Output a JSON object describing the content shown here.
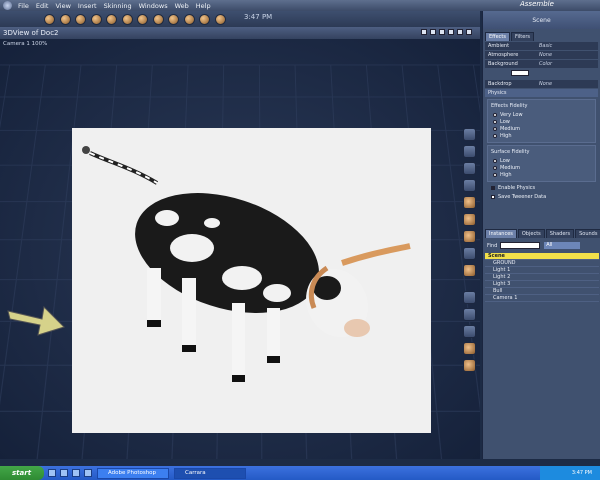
{
  "menu": {
    "items": [
      "File",
      "Edit",
      "View",
      "Insert",
      "Skinning",
      "Windows",
      "Web",
      "Help"
    ],
    "mode": "Assemble"
  },
  "toolbar": {
    "clock": "3:47 PM"
  },
  "viewport": {
    "title": "3DView of Doc2",
    "camera_label": "Camera 1 100%"
  },
  "panel": {
    "header": "Scene",
    "tabs": [
      "Effects",
      "Filters"
    ],
    "ambient": {
      "label": "Ambient",
      "value": "Basic"
    },
    "atmosphere": {
      "label": "Atmosphere",
      "value": "None"
    },
    "background": {
      "label": "Background",
      "value": "Color"
    },
    "backdrop": {
      "label": "Backdrop",
      "value": "None"
    },
    "physics": {
      "label": "Physics"
    },
    "effects_fidelity": {
      "title": "Effects Fidelity",
      "options": [
        "Very Low",
        "Low",
        "Medium",
        "High"
      ],
      "selected": "Medium"
    },
    "surface_fidelity": {
      "title": "Surface Fidelity",
      "options": [
        "Low",
        "Medium",
        "High"
      ],
      "selected": "Medium"
    },
    "enable_physics": "Enable Physics",
    "save_tweener": "Save Tweener Data"
  },
  "instances": {
    "tabs": [
      "Instances",
      "Objects",
      "Shaders",
      "Sounds"
    ],
    "find_label": "Find",
    "find_value": "",
    "filter_value": "All",
    "tree": [
      "Scene",
      "GROUND",
      "Light 1",
      "Light 2",
      "Light 3",
      "Bull",
      "Camera 1"
    ]
  },
  "taskbar": {
    "start": "start",
    "tasks": [
      "Adobe Photoshop",
      "Carrara"
    ],
    "clock": "3:47 PM"
  }
}
